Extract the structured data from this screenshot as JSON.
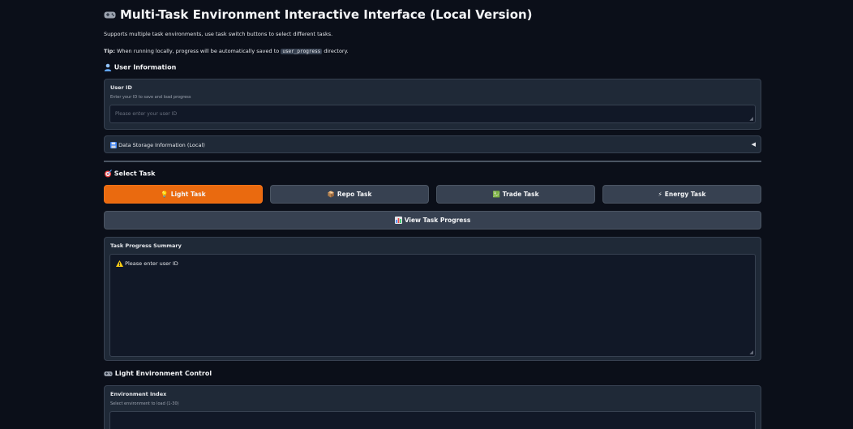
{
  "header": {
    "title": "Multi-Task Environment Interactive Interface (Local Version)",
    "title_icon": "gamepad-icon",
    "description": "Supports multiple task environments, use task switch buttons to select different tasks.",
    "tip_label": "Tip:",
    "tip_text": "When running locally, progress will be automatically saved to",
    "tip_code": "user_progress",
    "tip_suffix": "directory."
  },
  "user_info": {
    "heading": "User Information",
    "heading_icon": "user-icon",
    "user_id_label": "User ID",
    "user_id_hint": "Enter your ID to save and load progress",
    "user_id_placeholder": "Please enter your user ID",
    "user_id_value": ""
  },
  "storage_accordion": {
    "title": "Data Storage Information (Local)",
    "icon": "floppy-disk-icon",
    "arrow": "◀"
  },
  "task_select": {
    "heading": "Select Task",
    "heading_icon": "dart-icon",
    "tasks": [
      {
        "label": "Light Task",
        "icon": "bulb-icon",
        "glyph": "💡",
        "active": true
      },
      {
        "label": "Repo Task",
        "icon": "package-icon",
        "glyph": "📦",
        "active": false
      },
      {
        "label": "Trade Task",
        "icon": "chart-up-icon",
        "glyph": "💹",
        "active": false
      },
      {
        "label": "Energy Task",
        "icon": "lightning-icon",
        "glyph": "⚡",
        "active": false
      }
    ],
    "view_progress_label": "View Task Progress",
    "view_progress_icon": "bar-chart-icon"
  },
  "progress_summary": {
    "label": "Task Progress Summary",
    "value": "Please enter user ID",
    "warning_icon": "warning-icon"
  },
  "environment_control": {
    "heading": "Light Environment Control",
    "heading_icon": "gamepad-icon",
    "index_label": "Environment Index",
    "index_hint": "Select environment to load (1-30)"
  },
  "colors": {
    "background": "#0b0f19",
    "panel": "#1f2937",
    "accent": "#ea6a0f",
    "button": "#374151"
  }
}
